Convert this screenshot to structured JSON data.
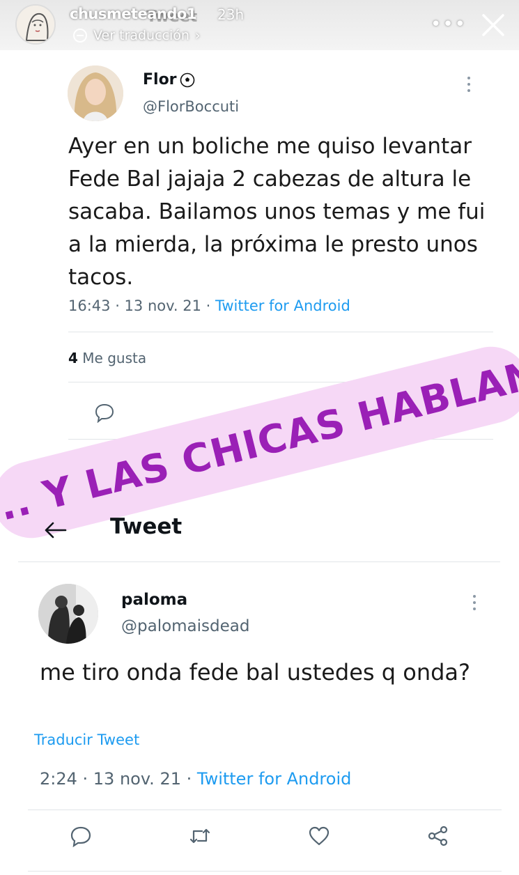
{
  "story": {
    "username": "chusmeteando1",
    "time": "23h",
    "translate_label": "Ver traducción",
    "ghost_title": "Tweet",
    "more_label": "•••"
  },
  "tweet1": {
    "name": "Flor",
    "handle": "@FlorBoccuti",
    "text": "Ayer en un boliche me quiso levantar Fede Bal jajaja 2 cabezas de altura le sacaba. Bailamos unos temas y me fui a la mierda, la próxima le presto unos tacos.",
    "time": "16:43 · 13 nov. 21 · ",
    "source": "Twitter for Android",
    "likes_count": "4",
    "likes_label": " Me gusta"
  },
  "banner": {
    "text": "... Y LAS CHICAS HABLAN"
  },
  "tweet2": {
    "header_title": "Tweet",
    "name": "paloma",
    "handle": "@palomaisdead",
    "text": "me tiro onda fede bal ustedes q onda?",
    "translate_label": "Traducir Tweet",
    "time": "2:24 · 13 nov. 21 · ",
    "source": "Twitter for Android"
  },
  "colors": {
    "accent": "#1d9bf0",
    "banner_bg": "#f6d8f6",
    "banner_text": "#9a20b6",
    "muted": "#536471"
  },
  "icons": [
    "close-icon",
    "kebab-icon",
    "soccer-ball-icon",
    "reply-icon",
    "share-icon",
    "back-arrow-icon",
    "retweet-icon",
    "like-icon",
    "chevron-right-icon"
  ]
}
